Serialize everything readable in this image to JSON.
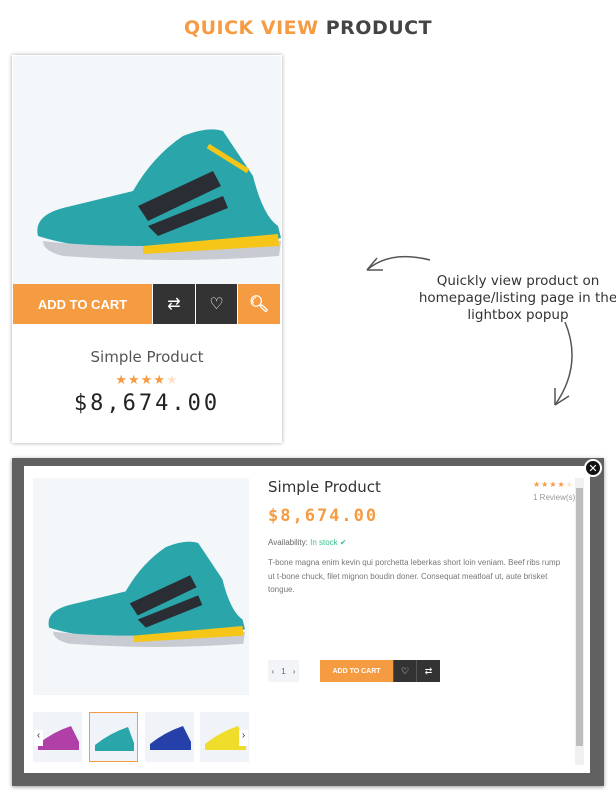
{
  "heading": {
    "accent": "QUICK VIEW",
    "rest": "PRODUCT"
  },
  "card": {
    "add_to_cart": "ADD TO CART",
    "name": "Simple Product",
    "rating": 4,
    "rating_max": 5,
    "price": "$8,674.00"
  },
  "note": "Quickly view product on homepage/listing page in the lightbox popup",
  "modal": {
    "name": "Simple Product",
    "price": "$8,674.00",
    "rating": 4,
    "reviews": "1 Review(s)",
    "availability_label": "Availability:",
    "availability_value": "In stock",
    "description": "T-bone magna enim kevin qui porchetta leberkas short loin veniam. Beef ribs rump ut t-bone chuck, filet mignon boudin doner. Consequat meatloaf ut, aute brisket tongue.",
    "qty": "1",
    "add_to_cart": "ADD TO CART",
    "thumbs": [
      "pink",
      "teal",
      "blue",
      "yellow"
    ],
    "selected_thumb": 1
  },
  "colors": {
    "accent": "#f59b42",
    "dark": "#333333",
    "stock": "#3cc08d"
  }
}
